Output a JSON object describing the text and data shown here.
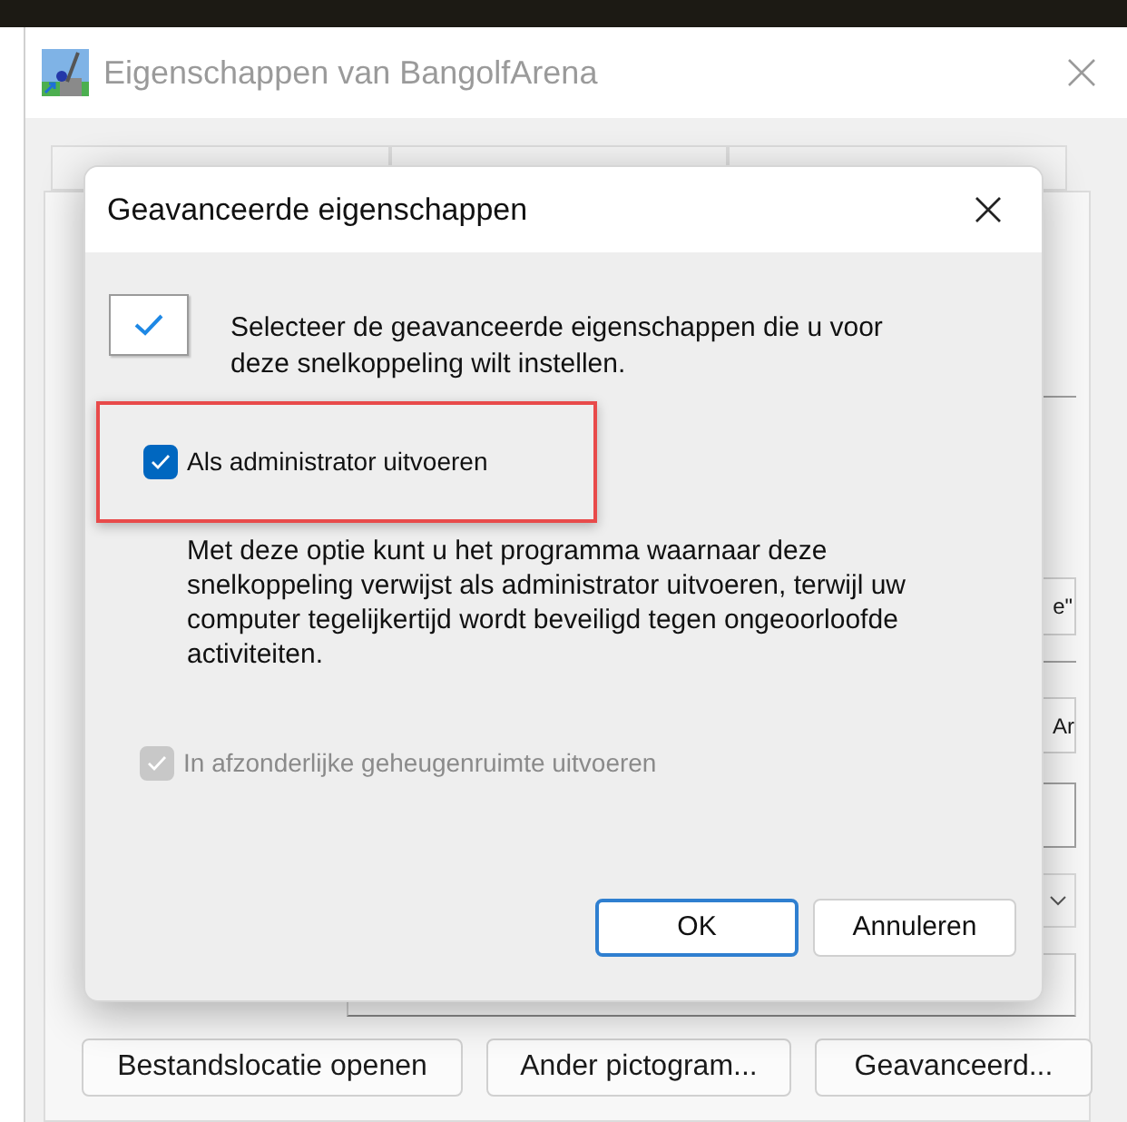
{
  "window": {
    "title": "Eigenschappen van BangolfArena"
  },
  "background": {
    "tabs": [
      {
        "selected": false
      },
      {
        "selected": false
      },
      {
        "selected": false
      }
    ],
    "fragments": [
      {
        "text": "e\""
      },
      {
        "text": "Ar"
      }
    ],
    "buttons": [
      "Bestandslocatie openen",
      "Ander pictogram...",
      "Geavanceerd..."
    ]
  },
  "dialog": {
    "title": "Geavanceerde eigenschappen",
    "intro": "Selecteer de geavanceerde eigenschappen die u voor deze snelkoppeling wilt instellen.",
    "options": [
      {
        "label": "Als administrator uitvoeren",
        "checked": true,
        "disabled": false,
        "highlighted": true,
        "description": "Met deze optie kunt u het programma waarnaar deze snelkoppeling verwijst als administrator uitvoeren, terwijl uw computer tegelijkertijd wordt beveiligd tegen ongeoorloofde activiteiten."
      },
      {
        "label": "In afzonderlijke geheugenruimte uitvoeren",
        "checked": true,
        "disabled": true,
        "highlighted": false
      }
    ],
    "buttons": [
      {
        "label": "OK",
        "default": true
      },
      {
        "label": "Annuleren",
        "default": false
      }
    ]
  }
}
